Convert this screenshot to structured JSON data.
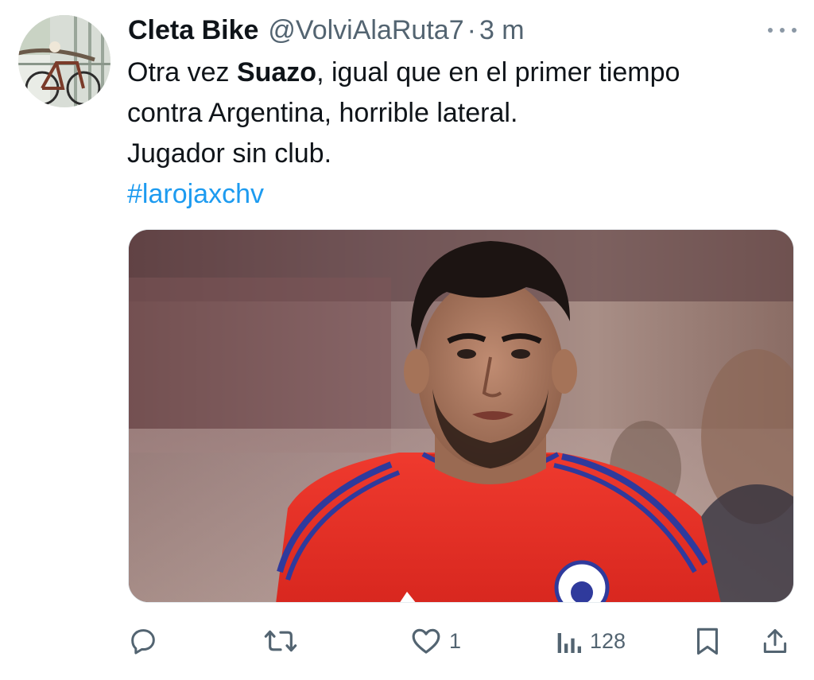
{
  "tweet": {
    "author": {
      "display_name": "Cleta Bike",
      "handle": "@VolviAlaRuta7",
      "separator": "·",
      "time": "3 m"
    },
    "text": {
      "line1_before": "Otra vez ",
      "line1_bold": "Suazo",
      "line1_after": ", igual que en el primer tiempo",
      "line2": "contra Argentina, horrible lateral.",
      "line3": "Jugador sin club.",
      "hashtag": "#larojaxchv"
    },
    "media": {
      "description_icon": "photo-soccer-player-red-jersey"
    },
    "actions": {
      "reply": {
        "icon": "reply-icon",
        "count": ""
      },
      "retweet": {
        "icon": "retweet-icon",
        "count": ""
      },
      "like": {
        "icon": "heart-icon",
        "count": "1"
      },
      "views": {
        "icon": "views-chart-icon",
        "count": "128"
      },
      "bookmark": {
        "icon": "bookmark-icon"
      },
      "share": {
        "icon": "share-icon"
      }
    }
  },
  "colors": {
    "text": "#0f1419",
    "secondary": "#536471",
    "link": "#1d9bf0",
    "jersey_red": "#e8332b",
    "jersey_blue": "#2f3a9c"
  }
}
